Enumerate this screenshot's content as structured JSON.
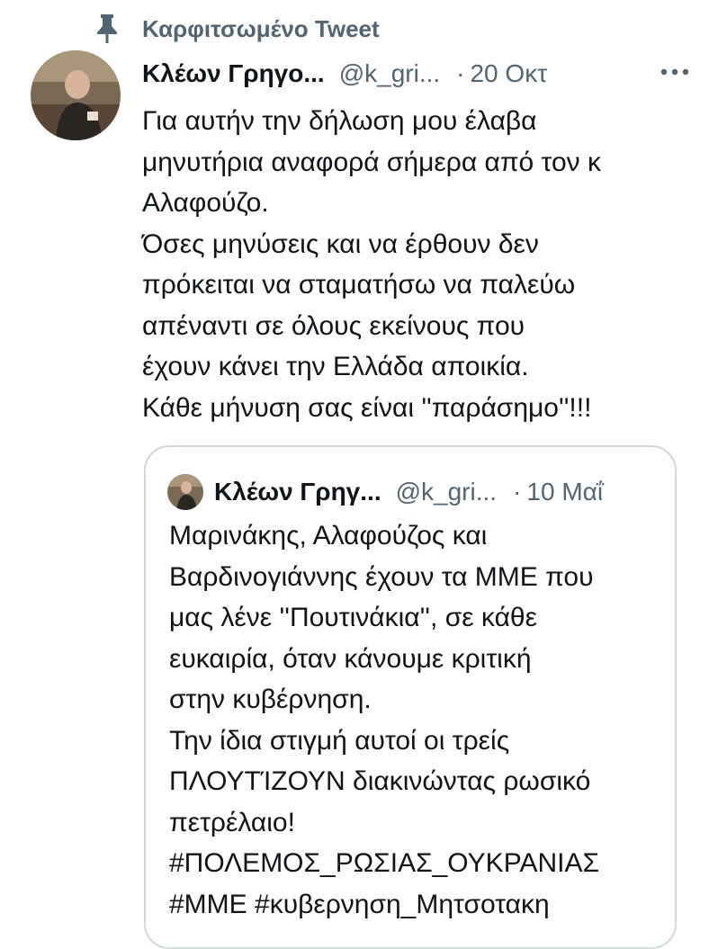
{
  "pinned": {
    "label": "Καρφιτσωμένο Tweet",
    "icon": "pin-icon"
  },
  "tweet": {
    "author_name": "Κλέων Γρηγο...",
    "handle": "@k_gri...",
    "separator": "·",
    "date": "20 Οκτ",
    "more_icon": "more-icon",
    "text_lines": [
      "Για αυτήν την δήλωση μου έλαβα",
      "μηνυτήρια αναφορά σήμερα από τον κ",
      "Αλαφούζο.",
      "Όσες μηνύσεις και να έρθουν δεν",
      "πρόκειται να σταματήσω να παλεύω",
      "απέναντι σε όλους εκείνους που",
      "έχουν κάνει την Ελλάδα αποικία.",
      "Κάθε μήνυση σας είναι ''παράσημο''!!!"
    ]
  },
  "quoted_tweet": {
    "author_name": "Κλέων Γρηγ...",
    "handle": "@k_gri...",
    "separator": "·",
    "date": "10 Μαΐ",
    "text_lines": [
      "Μαρινάκης, Αλαφούζος και",
      "Βαρδινογιάννης έχουν τα ΜΜΕ που",
      "μας λένε ''Πουτινάκια'', σε κάθε",
      "ευκαιρία, όταν κάνουμε κριτική",
      "στην κυβέρνηση.",
      "Την ίδια στιγμή αυτοί οι τρείς",
      "ΠΛΟΥΤΊΖΟΥΝ διακινώντας ρωσικό",
      "πετρέλαιο!",
      "#ΠΟΛΕΜΟΣ_ΡΩΣΙΑΣ_ΟΥΚΡΑΝΙΑΣ",
      "#ΜΜΕ #κυβερνηση_Μητσοτακη"
    ]
  },
  "colors": {
    "text_primary": "#0f1419",
    "text_secondary": "#536471",
    "border": "#cfd9de"
  }
}
